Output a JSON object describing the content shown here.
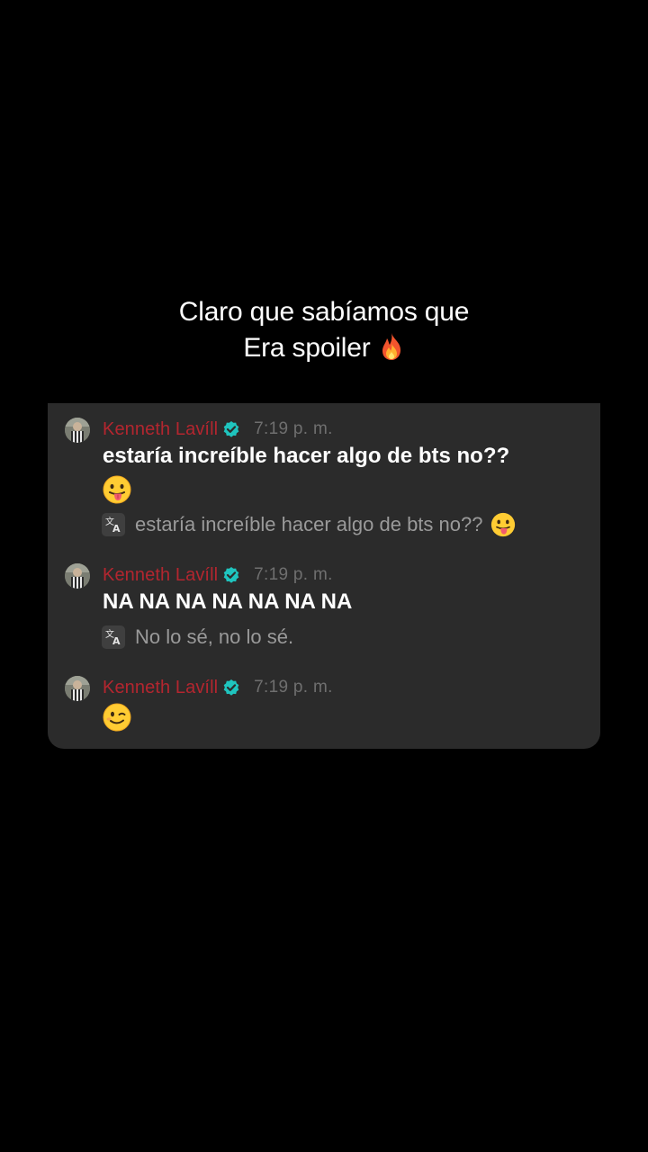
{
  "caption": {
    "line1": "Claro que sabíamos que",
    "line2": "Era spoiler",
    "line2_icon": "fire-icon"
  },
  "messages": [
    {
      "author": "Kenneth Lavíll",
      "verified_icon": "verified-badge-icon",
      "time": "7:19 p. m.",
      "text": "estaría increíble hacer algo de bts no??",
      "text_emoji": "tongue-out-emoji-icon",
      "translation": "estaría increíble hacer algo de bts no??",
      "translation_emoji": "tongue-out-emoji-icon"
    },
    {
      "author": "Kenneth Lavíll",
      "verified_icon": "verified-badge-icon",
      "time": "7:19 p. m.",
      "text": "NA NA NA NA NA NA NA",
      "translation": "No lo sé, no lo sé."
    },
    {
      "author": "Kenneth Lavíll",
      "verified_icon": "verified-badge-icon",
      "time": "7:19 p. m.",
      "text_emoji": "winking-face-emoji-icon"
    }
  ],
  "colors": {
    "background": "#000000",
    "card": "#2b2b2b",
    "author": "#b3262f",
    "verified": "#1fc4be",
    "timestamp": "#6f6f6f",
    "translation_text": "#9a9a9a"
  }
}
